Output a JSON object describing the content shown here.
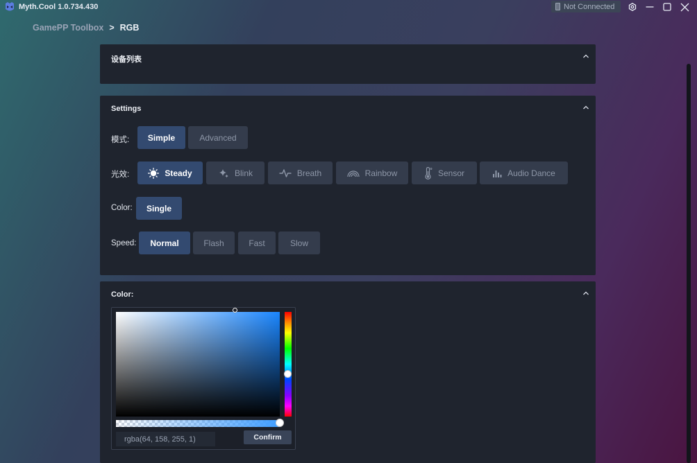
{
  "app": {
    "title": "Myth.Cool  1.0.734.430",
    "connection_status": "Not Connected"
  },
  "breadcrumb": {
    "parent": "GamePP Toolbox",
    "separator": ">",
    "current": "RGB"
  },
  "devices_panel": {
    "title": "设备列表"
  },
  "settings_panel": {
    "title": "Settings",
    "mode": {
      "label": "模式:",
      "options": [
        "Simple",
        "Advanced"
      ],
      "selected": "Simple"
    },
    "effect": {
      "label": "光效:",
      "options": [
        "Steady",
        "Blink",
        "Breath",
        "Rainbow",
        "Sensor",
        "Audio Dance"
      ],
      "selected": "Steady",
      "icons": [
        "sun-icon",
        "sparkle-icon",
        "pulse-icon",
        "rainbow-icon",
        "thermometer-icon",
        "equalizer-icon"
      ]
    },
    "color": {
      "label": "Color:",
      "options": [
        "Single"
      ],
      "selected": "Single"
    },
    "speed": {
      "label": "Speed:",
      "options": [
        "Normal",
        "Flash",
        "Fast",
        "Slow"
      ],
      "selected": "Normal"
    }
  },
  "color_panel": {
    "title": "Color:",
    "value": "rgba(64, 158, 255, 1)",
    "confirm_label": "Confirm",
    "current_color": "#409eff",
    "alpha": 1
  },
  "colors": {
    "accent": "#334a70",
    "panel": "#1f242e",
    "button": "#343c4c"
  }
}
